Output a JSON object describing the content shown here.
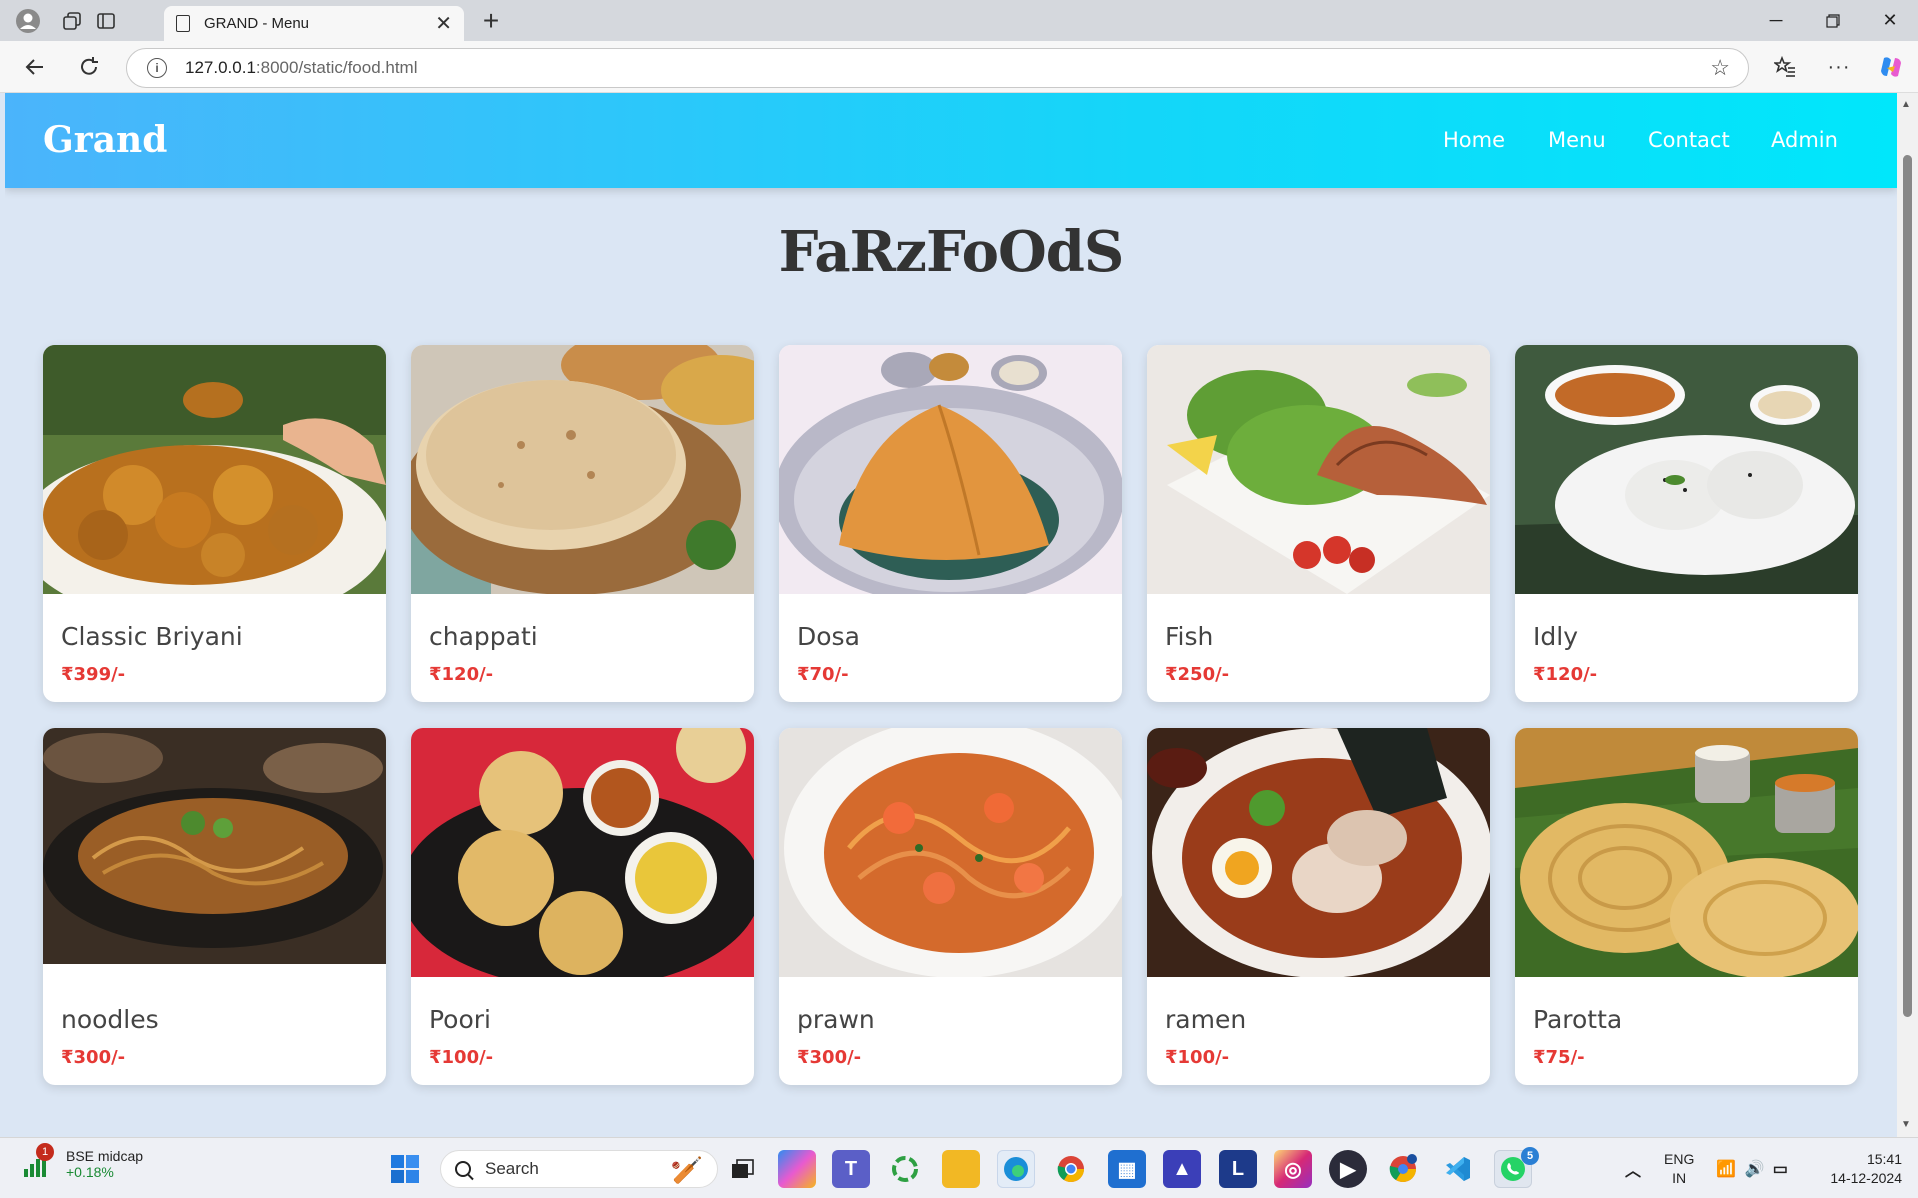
{
  "browser": {
    "tab_title": "GRAND - Menu",
    "url_host": "127.0.0.1",
    "url_path": ":8000/static/food.html"
  },
  "site": {
    "brand": "Grand",
    "nav": [
      "Home",
      "Menu",
      "Contact",
      "Admin"
    ],
    "heading": "FaRzFoOdS"
  },
  "menu": [
    {
      "name": "Classic Briyani",
      "price": "₹399/-"
    },
    {
      "name": "chappati",
      "price": "₹120/-"
    },
    {
      "name": "Dosa",
      "price": "₹70/-"
    },
    {
      "name": "Fish",
      "price": "₹250/-"
    },
    {
      "name": "Idly",
      "price": "₹120/-"
    },
    {
      "name": "noodles",
      "price": "₹300/-"
    },
    {
      "name": "Poori",
      "price": "₹100/-"
    },
    {
      "name": "prawn",
      "price": "₹300/-"
    },
    {
      "name": "ramen",
      "price": "₹100/-"
    },
    {
      "name": "Parotta",
      "price": "₹75/-"
    }
  ],
  "taskbar": {
    "stock_name": "BSE midcap",
    "stock_change": "+0.18%",
    "stock_badge": "1",
    "search_label": "Search",
    "lang_1": "ENG",
    "lang_2": "IN",
    "time": "15:41",
    "date": "14-12-2024",
    "whatsapp_badge": "5"
  },
  "colors": {
    "nav_gradient_start": "#4bb4fb",
    "nav_gradient_end": "#00e7fb",
    "price": "#e53935",
    "page_bg": "#dbe6f4"
  }
}
